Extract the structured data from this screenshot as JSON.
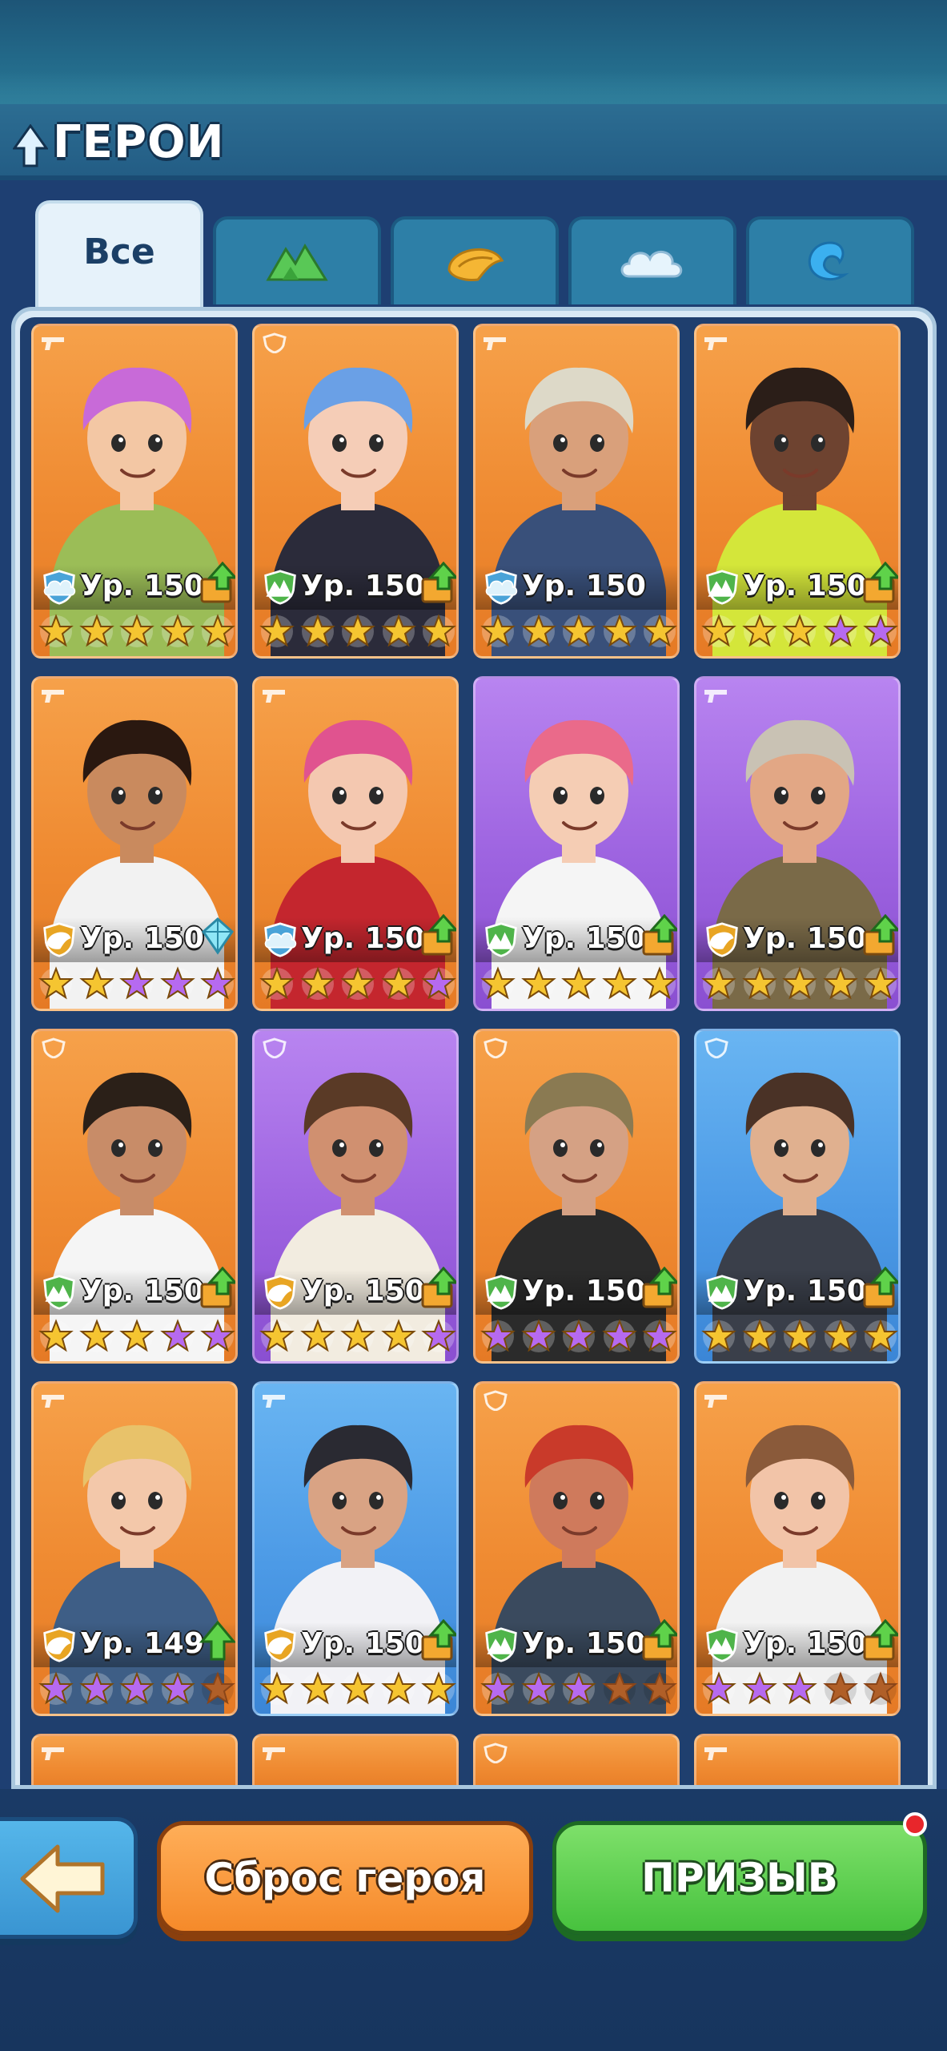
{
  "header": {
    "title": "ГЕРОИ"
  },
  "tabs": [
    {
      "label": "Все",
      "icon": "all-label",
      "active": true
    },
    {
      "label": "",
      "icon": "mountain-icon",
      "color": "#5ac85a",
      "active": false
    },
    {
      "label": "",
      "icon": "shell-icon",
      "color": "#f4b63a",
      "active": false
    },
    {
      "label": "",
      "icon": "cloud-icon",
      "color": "#dff1fb",
      "active": false
    },
    {
      "label": "",
      "icon": "wave-icon",
      "color": "#3bb0f0",
      "active": false
    }
  ],
  "heroes": [
    {
      "bg": "orange",
      "role": "gun",
      "element": "cloud",
      "level": "Ур. 150",
      "upgrade": true,
      "stars": [
        "gold",
        "gold",
        "gold",
        "gold",
        "gold"
      ],
      "hair": "#c86ad8",
      "skin": "#f3c7a4",
      "outfit": "#9bbd57"
    },
    {
      "bg": "orange",
      "role": "shield",
      "element": "mountain",
      "level": "Ур. 150",
      "upgrade": true,
      "stars": [
        "gold",
        "gold",
        "gold",
        "gold",
        "gold"
      ],
      "hair": "#6aa0e6",
      "skin": "#f5cdb7",
      "outfit": "#2b2b3a"
    },
    {
      "bg": "orange",
      "role": "gun",
      "element": "cloud",
      "level": "Ур. 150",
      "upgrade": false,
      "stars": [
        "gold",
        "gold",
        "gold",
        "gold",
        "gold"
      ],
      "hair": "#ddd9c8",
      "skin": "#d9a07b",
      "outfit": "#39507a"
    },
    {
      "bg": "orange",
      "role": "gun",
      "element": "mountain",
      "level": "Ур. 150",
      "upgrade": true,
      "stars": [
        "gold",
        "gold",
        "gold",
        "purple",
        "purple"
      ],
      "hair": "#2b1e18",
      "skin": "#6e4330",
      "outfit": "#d4e63a"
    },
    {
      "bg": "orange",
      "role": "gun",
      "element": "shell",
      "level": "Ур. 150",
      "upgrade": "gem",
      "stars": [
        "gold",
        "gold",
        "purple",
        "purple",
        "purple"
      ],
      "hair": "#2a1810",
      "skin": "#c98a5e",
      "outfit": "#f2f2f2"
    },
    {
      "bg": "orange",
      "role": "gun",
      "element": "cloud",
      "level": "Ур. 150",
      "upgrade": true,
      "stars": [
        "gold",
        "gold",
        "gold",
        "gold",
        "purple"
      ],
      "hair": "#e0538f",
      "skin": "#f4c8b0",
      "outfit": "#c4262e"
    },
    {
      "bg": "purple",
      "role": "none",
      "element": "mountain",
      "level": "Ур. 150",
      "upgrade": true,
      "stars": [
        "gold",
        "gold",
        "gold",
        "gold",
        "gold"
      ],
      "hair": "#ea6a8a",
      "skin": "#f5cdb4",
      "outfit": "#f5f5f5"
    },
    {
      "bg": "purple",
      "role": "gun",
      "element": "shell",
      "level": "Ур. 150",
      "upgrade": true,
      "stars": [
        "gold",
        "gold",
        "gold",
        "gold",
        "gold"
      ],
      "hair": "#c9c2b4",
      "skin": "#e2a785",
      "outfit": "#7a6a48"
    },
    {
      "bg": "orange",
      "role": "shield",
      "element": "mountain",
      "level": "Ур. 150",
      "upgrade": true,
      "stars": [
        "gold",
        "gold",
        "gold",
        "purple",
        "purple"
      ],
      "hair": "#2b2018",
      "skin": "#c88c68",
      "outfit": "#f5f5f5"
    },
    {
      "bg": "purple",
      "role": "shield",
      "element": "shell",
      "level": "Ур. 150",
      "upgrade": true,
      "stars": [
        "gold",
        "gold",
        "gold",
        "gold",
        "purple"
      ],
      "hair": "#5a3a26",
      "skin": "#d09070",
      "outfit": "#f2ece0"
    },
    {
      "bg": "orange",
      "role": "shield",
      "element": "mountain",
      "level": "Ур. 150",
      "upgrade": true,
      "stars": [
        "purple",
        "purple",
        "purple",
        "purple",
        "purple"
      ],
      "hair": "#8a7a52",
      "skin": "#d5a184",
      "outfit": "#2b2b2b"
    },
    {
      "bg": "blue",
      "role": "shield",
      "element": "mountain",
      "level": "Ур. 150",
      "upgrade": true,
      "stars": [
        "gold",
        "gold",
        "gold",
        "gold",
        "gold"
      ],
      "hair": "#4a3226",
      "skin": "#e0b08f",
      "outfit": "#3a3f4a"
    },
    {
      "bg": "orange",
      "role": "gun",
      "element": "shell",
      "level": "Ур. 149",
      "upgrade": "green",
      "stars": [
        "purple",
        "purple",
        "purple",
        "purple",
        "empty"
      ],
      "hair": "#e8c26a",
      "skin": "#f3c8aa",
      "outfit": "#3e5e86"
    },
    {
      "bg": "blue",
      "role": "gun",
      "element": "shell",
      "level": "Ур. 150",
      "upgrade": true,
      "stars": [
        "gold",
        "gold",
        "gold",
        "gold",
        "gold"
      ],
      "hair": "#2a2a32",
      "skin": "#d9a384",
      "outfit": "#f2f2f6"
    },
    {
      "bg": "orange",
      "role": "shield",
      "element": "mountain",
      "level": "Ур. 150",
      "upgrade": true,
      "stars": [
        "purple",
        "purple",
        "purple",
        "empty",
        "empty"
      ],
      "hair": "#c93a2a",
      "skin": "#cf7a5c",
      "outfit": "#3a4a5e"
    },
    {
      "bg": "orange",
      "role": "gun",
      "element": "mountain",
      "level": "Ур. 150",
      "upgrade": true,
      "stars": [
        "purple",
        "purple",
        "purple",
        "empty",
        "empty"
      ],
      "hair": "#8a5a3a",
      "skin": "#f2c4a8",
      "outfit": "#f2f2f2"
    }
  ],
  "partial_row": [
    {
      "role": "gun"
    },
    {
      "role": "gun"
    },
    {
      "role": "shield"
    },
    {
      "role": "gun"
    }
  ],
  "footer": {
    "back_icon": "arrow-left-icon",
    "reset_label": "Сброс героя",
    "summon_label": "ПРИЗЫВ",
    "summon_has_notification": true
  },
  "colors": {
    "gold_star": "#f5c531",
    "purple_star": "#b66af0",
    "empty_star": "#b05f28"
  }
}
